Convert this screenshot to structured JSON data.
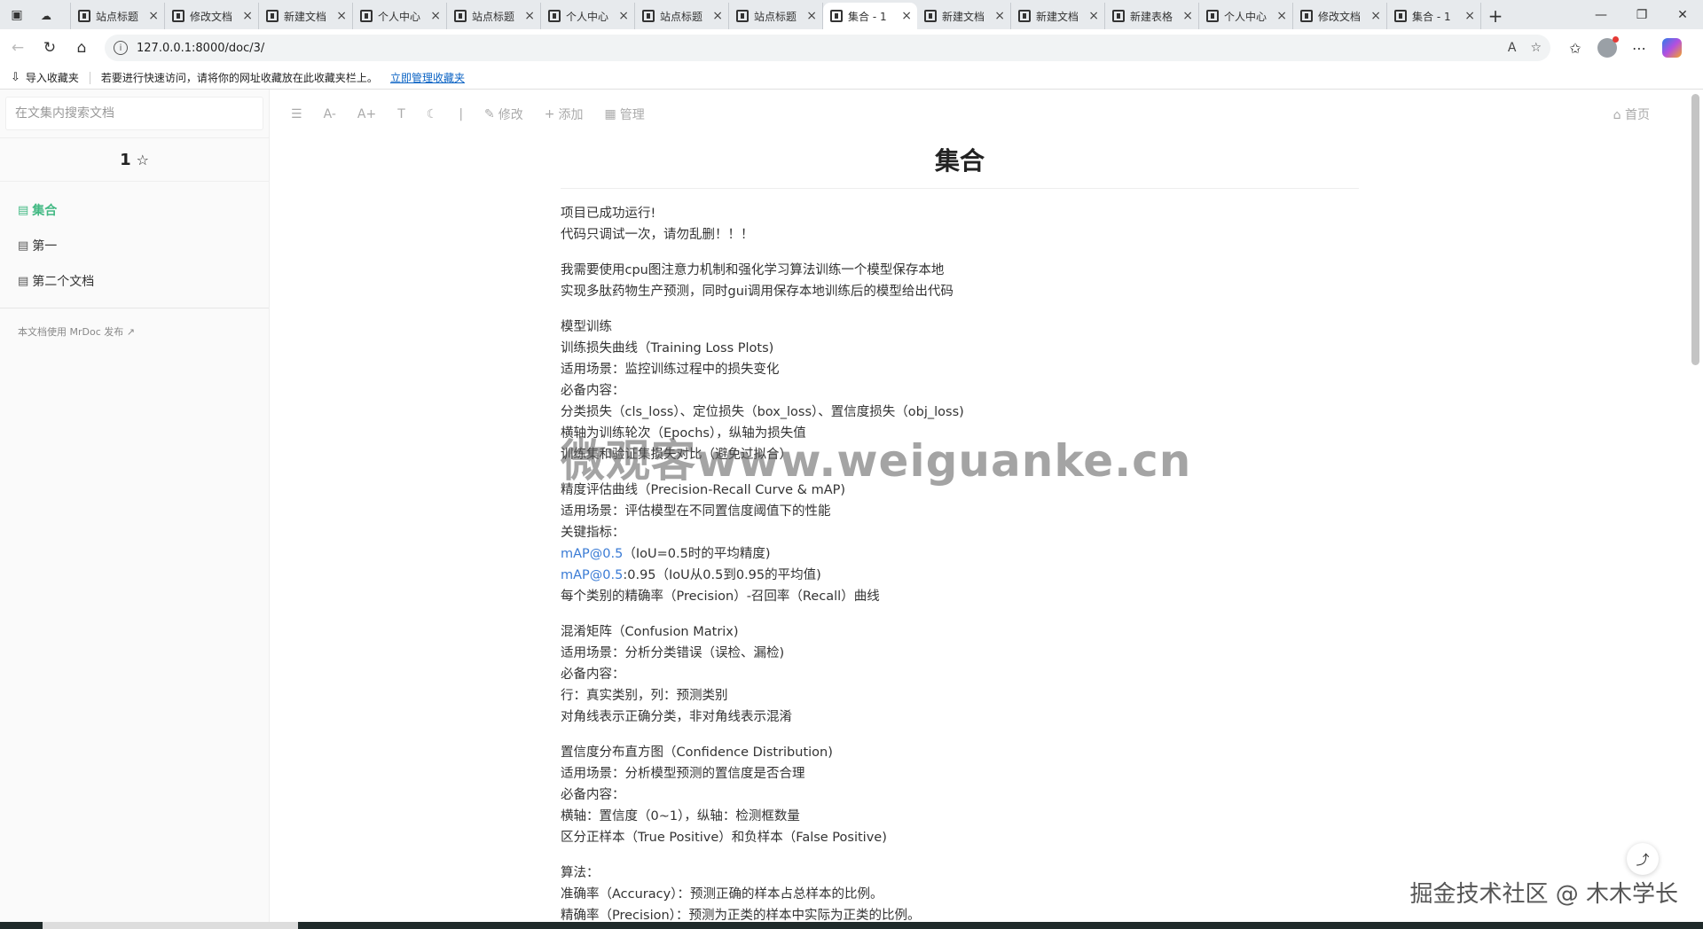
{
  "browser": {
    "tabs": [
      {
        "label": "站点标题",
        "active": false
      },
      {
        "label": "修改文档",
        "active": false
      },
      {
        "label": "新建文档",
        "active": false
      },
      {
        "label": "个人中心",
        "active": false
      },
      {
        "label": "站点标题",
        "active": false
      },
      {
        "label": "个人中心",
        "active": false
      },
      {
        "label": "站点标题",
        "active": false
      },
      {
        "label": "站点标题",
        "active": false
      },
      {
        "label": "集合 - 1",
        "active": true
      },
      {
        "label": "新建文档",
        "active": false
      },
      {
        "label": "新建文档",
        "active": false
      },
      {
        "label": "新建表格",
        "active": false
      },
      {
        "label": "个人中心",
        "active": false
      },
      {
        "label": "修改文档",
        "active": false
      },
      {
        "label": "集合 - 1",
        "active": false
      }
    ],
    "url": "127.0.0.1:8000/doc/3/",
    "favorites_bar": {
      "import_label": "导入收藏夹",
      "hint": "若要进行快速访问，请将你的网址收藏放在此收藏夹栏上。",
      "manage_link": "立即管理收藏夹"
    }
  },
  "sidebar": {
    "search_placeholder": "在文集内搜索文档",
    "collection_title": "1",
    "docs": [
      {
        "label": "集合",
        "active": true
      },
      {
        "label": "第一",
        "active": false
      },
      {
        "label": "第二个文档",
        "active": false
      }
    ],
    "powered_by": "本文档使用 MrDoc 发布"
  },
  "toolbar": {
    "edit_label": "修改",
    "add_label": "添加",
    "manage_label": "管理",
    "home_label": "首页"
  },
  "doc": {
    "title": "集合",
    "paragraphs": [
      [
        "项目已成功运行!",
        "代码只调试一次，请勿乱删！！！"
      ],
      [
        "我需要使用cpu图注意力机制和强化学习算法训练一个模型保存本地",
        "实现多肽药物生产预测，同时gui调用保存本地训练后的模型给出代码"
      ],
      [
        "模型训练",
        "训练损失曲线（Training Loss Plots)",
        "适用场景：监控训练过程中的损失变化",
        "必备内容：",
        "分类损失（cls_loss）、定位损失（box_loss）、置信度损失（obj_loss)",
        "横轴为训练轮次（Epochs），纵轴为损失值",
        "训练集和验证集损失对比（避免过拟合）"
      ],
      [
        "精度评估曲线（Precision-Recall Curve & mAP)",
        "适用场景：评估模型在不同置信度阈值下的性能",
        "关键指标：",
        "mAP@0.5（IoU=0.5时的平均精度)",
        "mAP@0.5:0.95（IoU从0.5到0.95的平均值)",
        "每个类别的精确率（Precision）-召回率（Recall）曲线"
      ],
      [
        "混淆矩阵（Confusion Matrix)",
        "适用场景：分析分类错误（误检、漏检)",
        "必备内容：",
        "行：真实类别，列：预测类别",
        "对角线表示正确分类，非对角线表示混淆"
      ],
      [
        "置信度分布直方图（Confidence Distribution)",
        "适用场景：分析模型预测的置信度是否合理",
        "必备内容：",
        "横轴：置信度（0~1），纵轴：检测框数量",
        "区分正样本（True Positive）和负样本（False Positive)"
      ],
      [
        "算法：",
        "准确率（Accuracy）：预测正确的样本占总样本的比例。",
        "精确率（Precision）：预测为正类的样本中实际为正类的比例。"
      ]
    ],
    "link_text": "mAP@0.5"
  },
  "watermarks": {
    "main": "微观客www.weiguanke.cn",
    "corner": "掘金技术社区 @ 木木学长"
  }
}
